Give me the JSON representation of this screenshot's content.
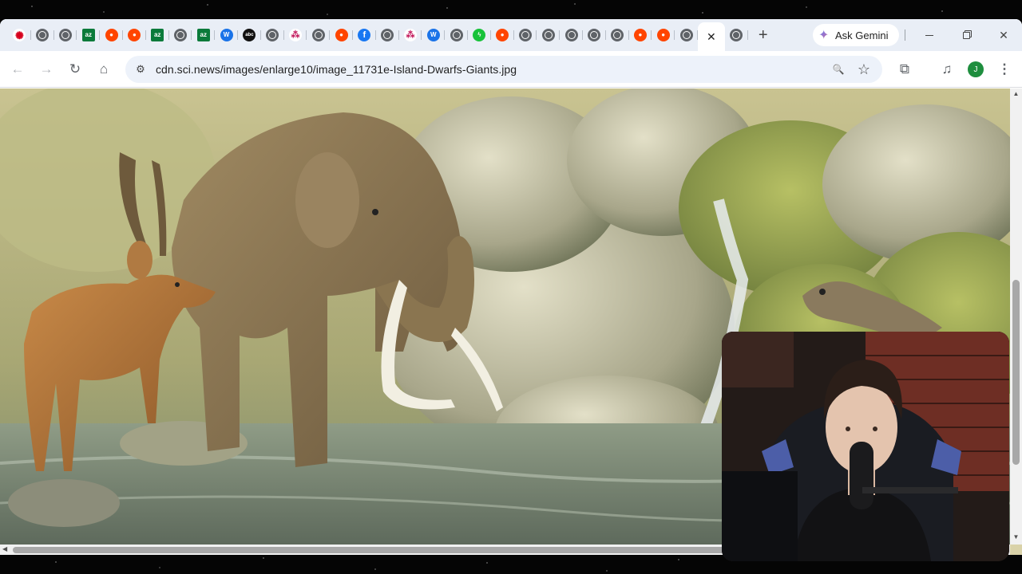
{
  "browser": {
    "tabs": [
      {
        "icon": "cbc-icon",
        "glyph": "✺",
        "kind": "cbc"
      },
      {
        "icon": "globe-icon",
        "glyph": "",
        "kind": "globe"
      },
      {
        "icon": "globe-icon",
        "glyph": "",
        "kind": "globe"
      },
      {
        "icon": "az-icon",
        "glyph": "az",
        "kind": "az"
      },
      {
        "icon": "reddit-icon",
        "glyph": "●",
        "kind": "reddit"
      },
      {
        "icon": "reddit-icon",
        "glyph": "●",
        "kind": "reddit"
      },
      {
        "icon": "az-icon",
        "glyph": "az",
        "kind": "az"
      },
      {
        "icon": "globe-icon",
        "glyph": "",
        "kind": "globe"
      },
      {
        "icon": "az-icon",
        "glyph": "az",
        "kind": "az"
      },
      {
        "icon": "wikipedia-icon",
        "glyph": "W",
        "kind": "wiki"
      },
      {
        "icon": "abc-icon",
        "glyph": "abc",
        "kind": "abc"
      },
      {
        "icon": "globe-icon",
        "glyph": "",
        "kind": "globe"
      },
      {
        "icon": "motif-icon",
        "glyph": "⁂",
        "kind": "mot"
      },
      {
        "icon": "globe-icon",
        "glyph": "",
        "kind": "globe"
      },
      {
        "icon": "reddit-icon",
        "glyph": "●",
        "kind": "reddit"
      },
      {
        "icon": "facebook-icon",
        "glyph": "f",
        "kind": "fb"
      },
      {
        "icon": "globe-icon",
        "glyph": "",
        "kind": "globe"
      },
      {
        "icon": "motif-icon",
        "glyph": "⁂",
        "kind": "mot"
      },
      {
        "icon": "wikipedia-icon",
        "glyph": "W",
        "kind": "wiki"
      },
      {
        "icon": "globe-icon",
        "glyph": "",
        "kind": "globe"
      },
      {
        "icon": "bolt-icon",
        "glyph": "ϟ",
        "kind": "green"
      },
      {
        "icon": "reddit-icon",
        "glyph": "●",
        "kind": "reddit"
      },
      {
        "icon": "globe-icon",
        "glyph": "",
        "kind": "globe"
      },
      {
        "icon": "globe-icon",
        "glyph": "",
        "kind": "globe"
      },
      {
        "icon": "globe-icon",
        "glyph": "",
        "kind": "globe"
      },
      {
        "icon": "globe-icon",
        "glyph": "",
        "kind": "globe"
      },
      {
        "icon": "globe-icon",
        "glyph": "",
        "kind": "globe"
      },
      {
        "icon": "reddit-icon",
        "glyph": "●",
        "kind": "reddit"
      },
      {
        "icon": "reddit-icon",
        "glyph": "●",
        "kind": "reddit"
      },
      {
        "icon": "globe-icon",
        "glyph": "",
        "kind": "globe"
      }
    ],
    "active_tab": {
      "close_glyph": "✕"
    },
    "after_active_tab": {
      "icon": "globe-icon",
      "kind": "globe"
    },
    "new_tab_glyph": "+",
    "gemini_label": "Ask Gemini",
    "window_controls": {
      "close_glyph": "✕"
    },
    "toolbar": {
      "back_glyph": "←",
      "forward_glyph": "→",
      "reload_glyph": "↻",
      "home_glyph": "⌂",
      "site_info_glyph": "⚙",
      "zoom_glyph": "🔍",
      "bookmark_glyph": "☆",
      "cast_glyph": "⧉",
      "media_glyph": "♫",
      "menu_glyph": "⋮",
      "profile_initial": "J"
    },
    "address": {
      "url": "cdn.sci.news/images/enlarge10/image_11731e-Island-Dwarfs-Giants.jpg"
    }
  },
  "scrollbars": {
    "up_glyph": "▲",
    "down_glyph": "▼",
    "left_glyph": "◀",
    "right_glyph": "▶"
  }
}
